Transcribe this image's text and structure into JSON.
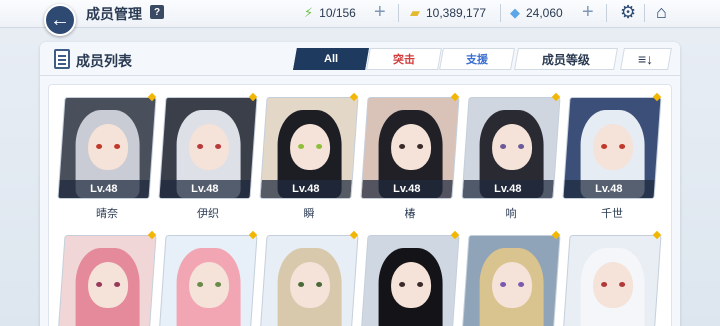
{
  "header": {
    "title": "成员管理",
    "help_label": "?",
    "stamina": "10/156",
    "credits": "10,389,177",
    "gems": "24,060"
  },
  "panel": {
    "title": "成员列表",
    "filters": [
      {
        "label": "All",
        "active": true
      },
      {
        "label": "突击",
        "active": false
      },
      {
        "label": "支援",
        "active": false
      }
    ],
    "sort_label": "成员等级",
    "order_label": "≡↓"
  },
  "members_row1": [
    {
      "name": "晴奈",
      "level": "Lv.48"
    },
    {
      "name": "伊织",
      "level": "Lv.48"
    },
    {
      "name": "瞬",
      "level": "Lv.48"
    },
    {
      "name": "椿",
      "level": "Lv.48"
    },
    {
      "name": "响",
      "level": "Lv.48"
    },
    {
      "name": "千世",
      "level": "Lv.48"
    }
  ],
  "colors": {
    "accent": "#1f3a5f",
    "striker": "#d13b3b",
    "special": "#3b6fd1",
    "star": "#f2b705"
  },
  "icons": {
    "back": "back-arrow-icon",
    "stamina": "lightning-icon",
    "credits": "credit-icon",
    "gems": "gem-icon",
    "settings": "gear-icon",
    "home": "home-icon"
  }
}
